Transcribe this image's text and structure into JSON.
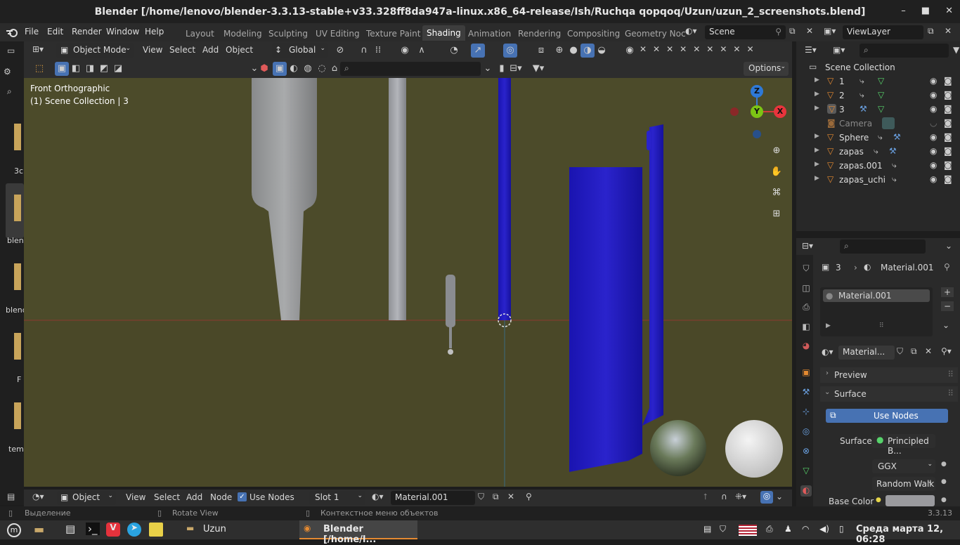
{
  "window": {
    "title": "Blender [/home/lenovo/blender-3.3.13-stable+v33.328ff8da947a-linux.x86_64-release/Ish/Ruchqa qopqoq/Uzun/uzun_2_screenshots.blend]",
    "minimize": "–",
    "maximize": "■",
    "close": "✕"
  },
  "menu": {
    "file": "File",
    "edit": "Edit",
    "render": "Render",
    "window": "Window",
    "help": "Help"
  },
  "workspaces": [
    "Layout",
    "Modeling",
    "Sculpting",
    "UV Editing",
    "Texture Paint",
    "Shading",
    "Animation",
    "Rendering",
    "Compositing",
    "Geometry Noc"
  ],
  "active_workspace": "Shading",
  "scene": {
    "label": "Scene"
  },
  "viewlayer": {
    "label": "ViewLayer"
  },
  "viewport_header": {
    "mode": "Object Mode",
    "view": "View",
    "select": "Select",
    "add": "Add",
    "object": "Object",
    "orientation": "Global",
    "options": "Options"
  },
  "viewport": {
    "view_name": "Front Orthographic",
    "collection_info": "(1) Scene Collection | 3",
    "gizmo": {
      "z": "Z",
      "y": "Y",
      "x": "X"
    }
  },
  "outliner": {
    "root": "Scene Collection",
    "items": [
      {
        "name": "1"
      },
      {
        "name": "2"
      },
      {
        "name": "3"
      },
      {
        "name": "Camera"
      },
      {
        "name": "Sphere"
      },
      {
        "name": "zapas"
      },
      {
        "name": "zapas.001"
      },
      {
        "name": "zapas_uchi"
      }
    ]
  },
  "properties": {
    "breadcrumb_object": "3",
    "breadcrumb_material": "Material.001",
    "slot_name": "Material.001",
    "material_field": "Material...",
    "preview": "Preview",
    "surface": "Surface",
    "use_nodes": "Use Nodes",
    "surface_label": "Surface",
    "surface_value": "Principled B...",
    "distribution": "GGX",
    "subsurface": "Random Walk",
    "base_color_label": "Base Color",
    "base_color": "#9a9a9e"
  },
  "node_header": {
    "editor": "Object",
    "view": "View",
    "select": "Select",
    "add": "Add",
    "node": "Node",
    "use_nodes": "Use Nodes",
    "slot": "Slot 1",
    "material": "Material.001"
  },
  "statusbar": {
    "select": "Выделение",
    "rotate": "Rotate View",
    "context": "Контекстное меню объектов",
    "version": "3.3.13"
  },
  "left_strip": {
    "labels": [
      "3c",
      "blen",
      "blend",
      "F",
      "tem"
    ]
  },
  "taskbar": {
    "folder_label": "Uzun",
    "blender_label": "Blender [/home/l...",
    "clock": "Среда марта 12, 06:28"
  },
  "colors": {
    "viewport_bg": "#4c4b2a",
    "blue_object": "#1d17b9",
    "accent": "#4772b3"
  }
}
